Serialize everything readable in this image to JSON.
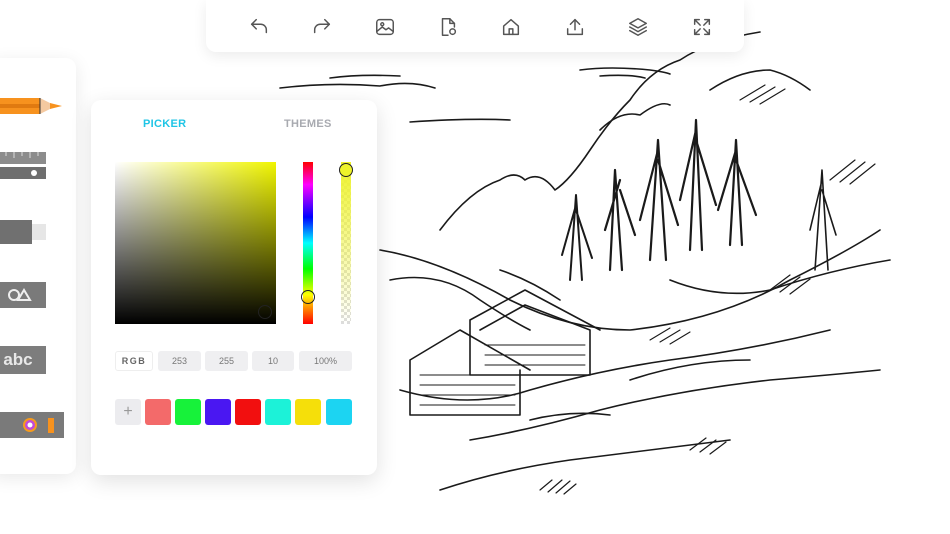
{
  "toolbar": {
    "buttons": [
      {
        "name": "undo-icon",
        "label": "Undo"
      },
      {
        "name": "redo-icon",
        "label": "Redo"
      },
      {
        "name": "image-icon",
        "label": "Image"
      },
      {
        "name": "file-settings-icon",
        "label": "File settings"
      },
      {
        "name": "home-icon",
        "label": "Home"
      },
      {
        "name": "upload-icon",
        "label": "Upload"
      },
      {
        "name": "layers-icon",
        "label": "Layers"
      },
      {
        "name": "fullscreen-icon",
        "label": "Fullscreen"
      }
    ]
  },
  "tools": {
    "pencil_color": "#f7921e",
    "eraser_color": "#707070",
    "text_tool_label": "abc"
  },
  "picker": {
    "tabs": {
      "picker": "PICKER",
      "themes": "THEMES"
    },
    "active_tab": "picker",
    "hue_color": "#f0f500",
    "rgb": {
      "label": "RGB",
      "r": "253",
      "g": "255",
      "b": "10",
      "alpha": "100%"
    },
    "add_swatch_label": "+",
    "swatches": [
      "#f36a6a",
      "#17f23a",
      "#4a17f2",
      "#f20f0f",
      "#1cf2d8",
      "#f5df0a",
      "#1cd4f2"
    ],
    "accent_color": "#20c5e6"
  }
}
